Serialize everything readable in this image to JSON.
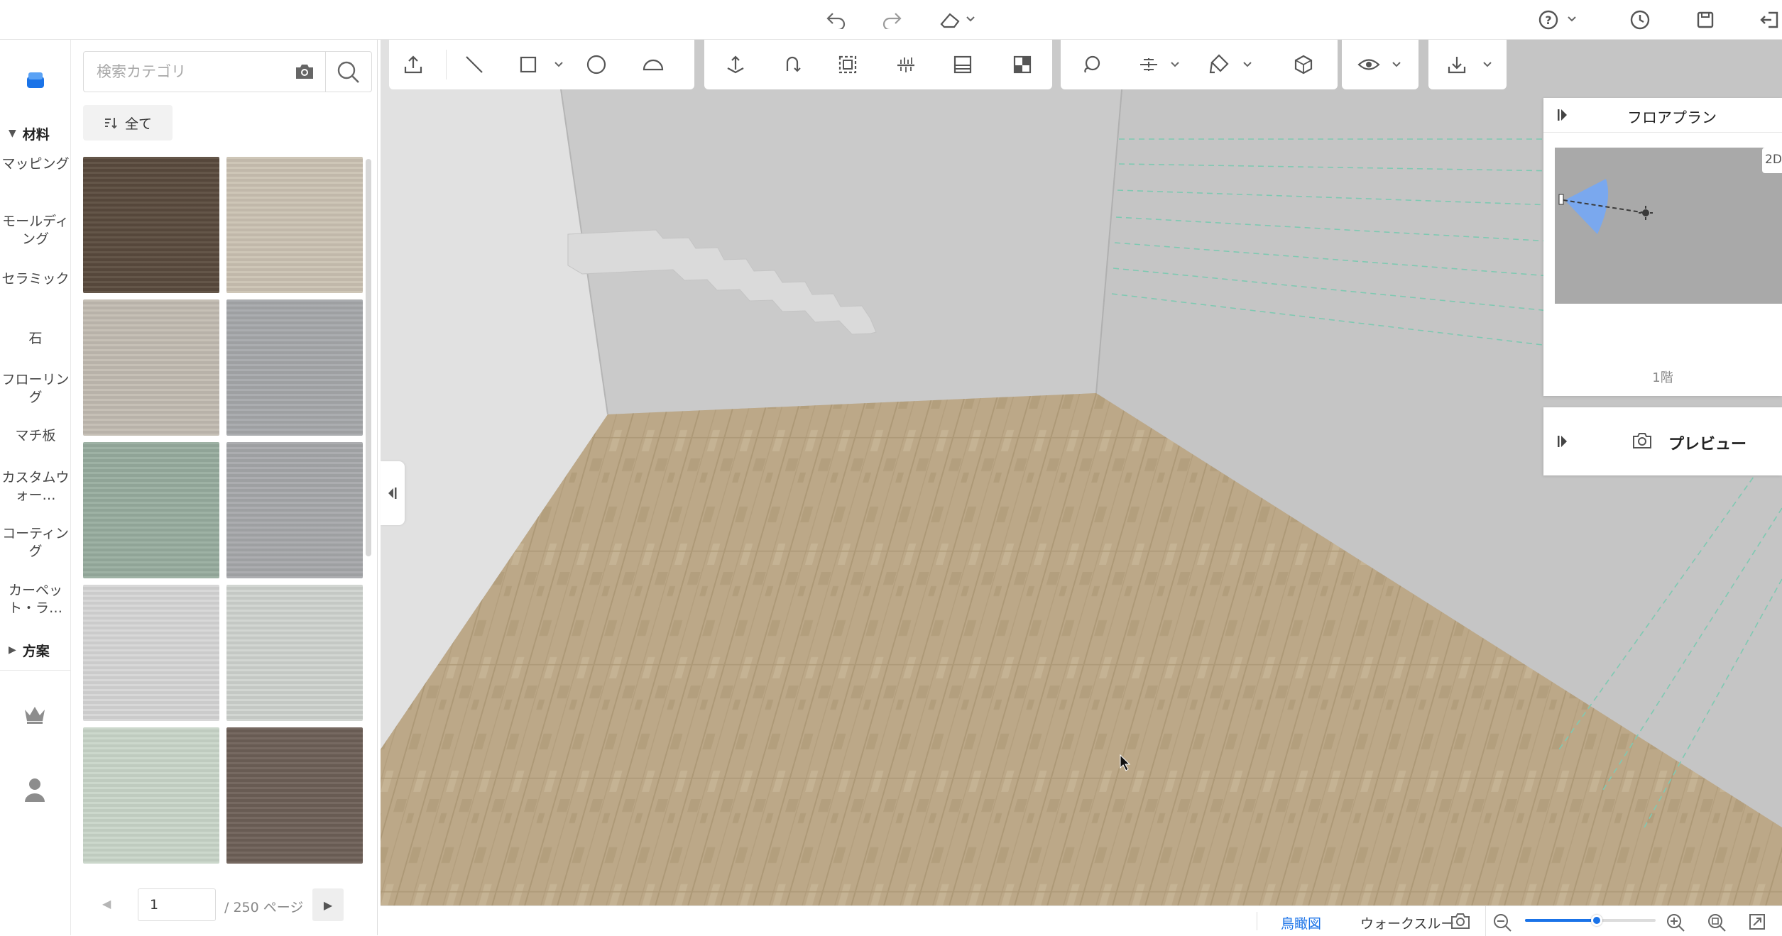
{
  "top_bar": {
    "icons": [
      "undo-icon",
      "redo-icon",
      "eraser-icon",
      "help-icon",
      "history-icon",
      "save-icon",
      "exit-icon"
    ]
  },
  "rail": {
    "group_materials": "材料",
    "items": [
      "マッピング",
      "モールディング",
      "セラミック",
      "石",
      "フローリング",
      "マチ板",
      "カスタムウォー…",
      "コーティング",
      "カーペット・ラ…"
    ],
    "group_plans": "方案"
  },
  "panel": {
    "search_placeholder": "検索カテゴリ",
    "filter_label": "全て",
    "swatch_colors": [
      "#5a4b3e",
      "#cbc2b3",
      "#c2bcb2",
      "#a6a8ab",
      "#98ad9f",
      "#a7a8ab",
      "#d6d6d6",
      "#cfd3cf",
      "#c9d6c9",
      "#6e6057"
    ],
    "pager": {
      "current_page": "1",
      "total_label": "/ 250 ページ"
    }
  },
  "floor_plan_panel": {
    "title": "フロアプラン",
    "badge": "2D",
    "floor_label": "1階"
  },
  "preview_panel": {
    "title": "プレビュー"
  },
  "status_bar": {
    "bird_view": "鳥瞰図",
    "walkthrough": "ウォークスルー",
    "zoom_level": 0.55
  },
  "colors": {
    "accent": "#1a73e8",
    "wall": "#c9c9c9",
    "floor": "#bca888"
  }
}
